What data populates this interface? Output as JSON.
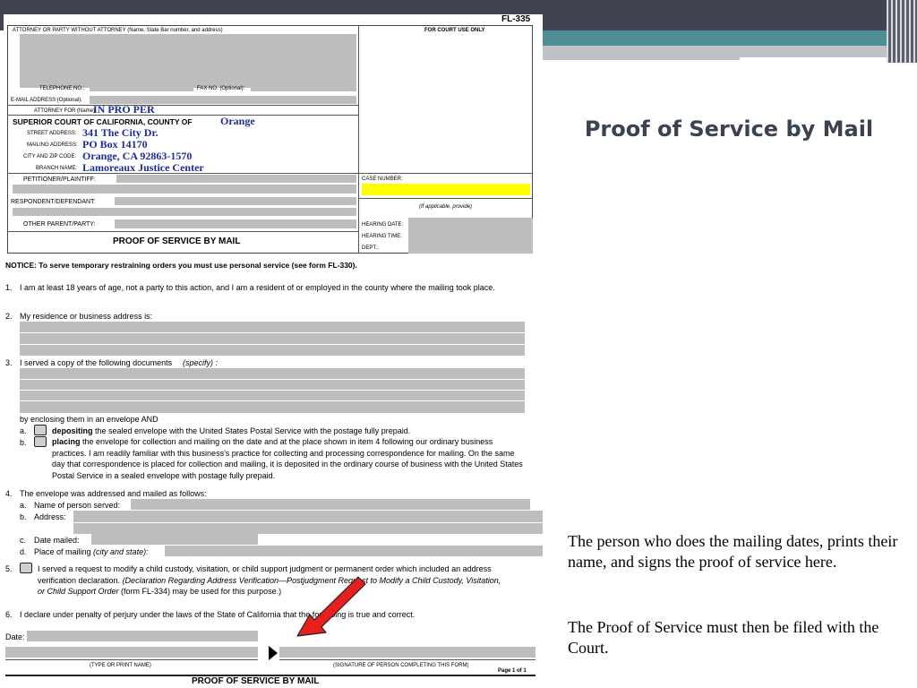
{
  "slide": {
    "title": "Proof of Service by Mail",
    "note1": "The person who does the mailing dates, prints their name, and signs the proof of service here.",
    "note2": "The Proof of Service must then be filed with the Court.",
    "colors": {
      "topbar": "#3f4450",
      "accent": "#4d8f95",
      "title": "#3b4250",
      "arrow": "#e8201c",
      "highlight": "#ffff00"
    }
  },
  "form": {
    "form_number": "FL-335",
    "attorney_header": "ATTORNEY OR PARTY WITHOUT ATTORNEY (Name, State Bar number, and address)",
    "court_use": "FOR COURT USE ONLY",
    "telephone": "TELEPHONE NO.:",
    "fax": "FAX NO. (Optional):",
    "email": "E-MAIL ADDRESS (Optional):",
    "attorney_for": "ATTORNEY FOR (Name):",
    "attorney_for_value": "IN PRO PER",
    "court_label": "SUPERIOR COURT OF CALIFORNIA, COUNTY OF",
    "county": "Orange",
    "street_label": "STREET ADDRESS:",
    "street": "341 The City Dr.",
    "mailing_label": "MAILING ADDRESS:",
    "mailing": "PO Box 14170",
    "city_label": "CITY AND ZIP CODE:",
    "city": "Orange, CA  92863-1570",
    "branch_label": "BRANCH NAME:",
    "branch": "Lamoreaux Justice Center",
    "petitioner": "PETITIONER/PLAINTIFF:",
    "respondent": "RESPONDENT/DEFENDANT:",
    "other_parent": "OTHER PARENT/PARTY:",
    "form_title": "PROOF OF SERVICE BY MAIL",
    "case_number": "CASE NUMBER:",
    "if_applicable": "(If applicable, provide)",
    "hearing_date": "HEARING DATE:",
    "hearing_time": "HEARING TIME:",
    "dept": "DEPT.:",
    "notice": "NOTICE: To serve temporary restraining orders you must use personal service (see form FL-330).",
    "item1_num": "1.",
    "item1": "I am at least 18 years of age, not a party to this action, and I am a resident of or employed in the county where the mailing took place.",
    "item2_num": "2.",
    "item2": "My residence or business address is:",
    "item3_num": "3.",
    "item3": "I served a copy of the following documents",
    "item3_specify": "(specify) :",
    "enclosing": "by enclosing them in an envelope AND",
    "a": "a.",
    "a_bold": "depositing",
    "a_text": " the sealed envelope with the United States Postal Service with the postage fully prepaid.",
    "b": "b.",
    "b_bold": "placing",
    "b_text": " the envelope for collection and mailing on the date and at the place shown in item 4 following our ordinary business practices. I am readily familiar with this business's practice for collecting and processing correspondence for mailing. On the same day that correspondence is placed for collection and mailing, it is deposited in the ordinary course of business with the United States Postal Service in a sealed envelope with postage fully prepaid.",
    "item4_num": "4.",
    "item4": "The envelope was addressed and mailed as follows:",
    "item4a_num": "a.",
    "item4a": "Name of person served:",
    "item4b_num": "b.",
    "item4b": "Address:",
    "item4c_num": "c.",
    "item4c": "Date mailed:",
    "item4d_num": "d.",
    "item4d": "Place of mailing",
    "item4d_it": " (city and state):",
    "item5_num": "5.",
    "item5_a": "I served a request to modify a child custody, visitation, or child support judgment or permanent order which included an address verification declaration. ",
    "item5_b": "(Declaration Regarding Address Verification—Postjudgment Request to Modify a Child Custody, Visitation, or Child Support Order",
    "item5_c": " (form FL-334) may be used for this purpose.)",
    "item6_num": "6.",
    "item6": "I declare under penalty of perjury under the laws of the State of California that the foregoing is true and correct.",
    "date": "Date:",
    "type_name": "(TYPE OR PRINT NAME)",
    "signature": "(SIGNATURE OF PERSON COMPLETING THIS FORM)",
    "page": "Page 1 of 1",
    "footer_title": "PROOF OF SERVICE BY MAIL"
  }
}
